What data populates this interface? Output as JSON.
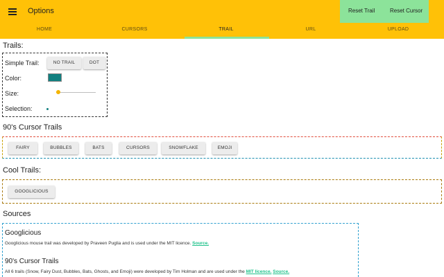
{
  "appbar": {
    "title": "Options",
    "reset_trail": "Reset Trail",
    "reset_cursor": "Reset Cursor",
    "accent": "#ffc107",
    "action_color": "#8ce39a"
  },
  "tabs": [
    {
      "label": "HOME"
    },
    {
      "label": "CURSORS"
    },
    {
      "label": "TRAIL",
      "active": true
    },
    {
      "label": "URL"
    },
    {
      "label": "UPLOAD"
    }
  ],
  "trails": {
    "heading": "Trails:",
    "simple_label": "Simple Trail:",
    "no_trail": "NO TRAIL",
    "dot": "DOT",
    "color_label": "Color:",
    "color_value": "#118080",
    "size_label": "Size:",
    "size_level": 0.05,
    "selection_label": "Selection:"
  },
  "nineties": {
    "heading": "90's Cursor Trails",
    "buttons": [
      "FAIRY",
      "BUBBLES",
      "BATS",
      "CURSORS",
      "SNOWFLAKE",
      "EMOJI"
    ]
  },
  "cool": {
    "heading": "Cool Trails:",
    "buttons": [
      "GOOGLICIOUS"
    ]
  },
  "sources": {
    "heading": "Sources",
    "googlicious_title": "Googlicious",
    "googlicious_text": "Googlicious mouse trail was developed by Praveen Puglia and is used under the MIT licence.",
    "source_link": "Source.",
    "nineties_title": "90's Cursor Trails",
    "nineties_text": "All 6 trails (Snow, Fairy Dust, Bubbles, Bats, Ghosts, and Emoji) were developed by Tim Holman and are used under the",
    "mit_link": "MIT licence.",
    "source_link2": "Source."
  }
}
